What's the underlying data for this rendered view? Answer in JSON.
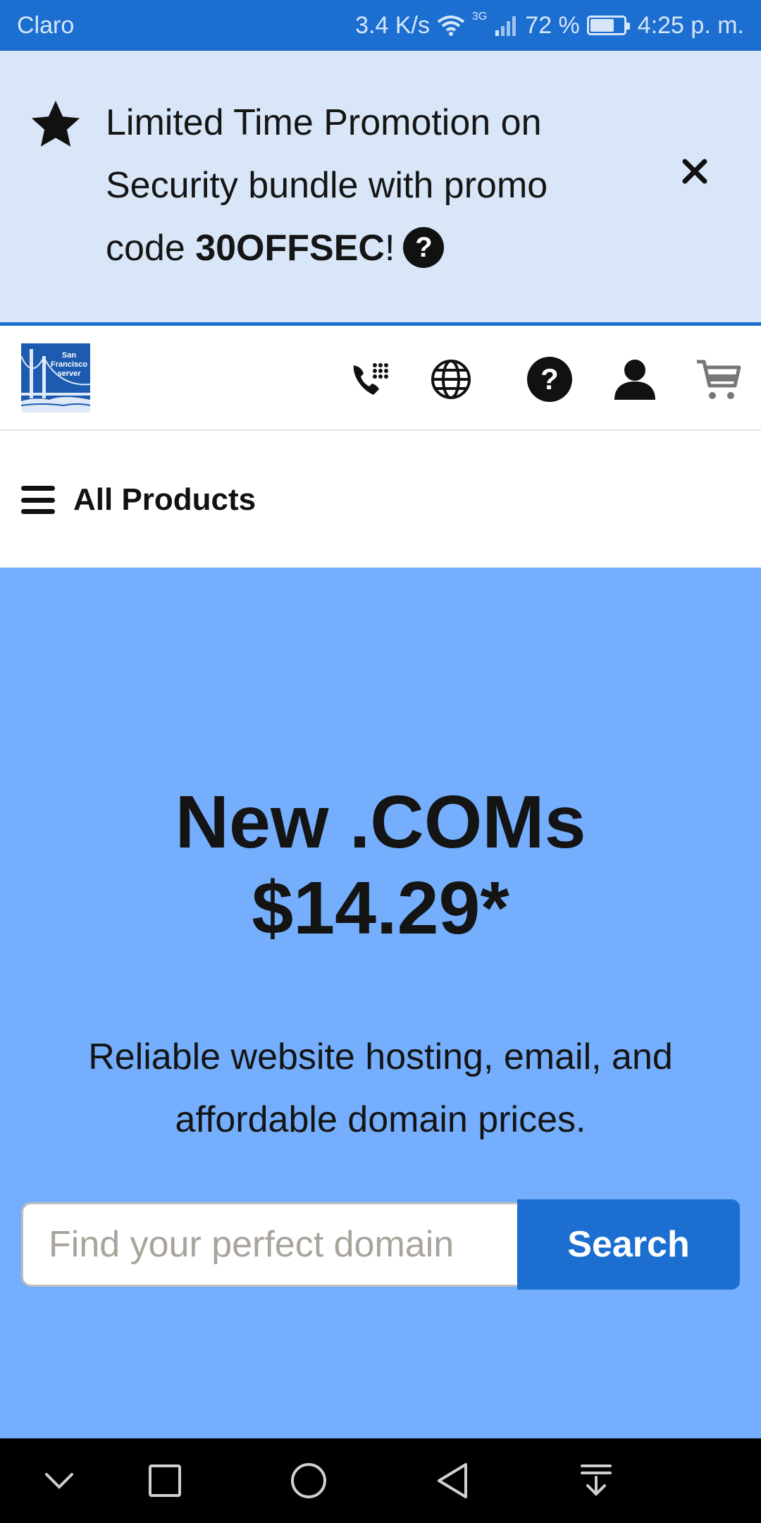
{
  "status_bar": {
    "carrier": "Claro",
    "speed": "3.4 K/s",
    "network": "3G",
    "battery": "72 %",
    "battery_level": 0.72,
    "time": "4:25 p. m."
  },
  "promo": {
    "line1": "Limited Time Promotion on",
    "line2": "Security bundle with promo",
    "line3_prefix": "code ",
    "code": "30OFFSEC",
    "line3_suffix": "!",
    "help_glyph": "?",
    "icons": {
      "star": "star-icon",
      "help": "help-icon",
      "close": "close-icon"
    }
  },
  "header": {
    "logo_text": "San Francisco server",
    "icons": [
      "phone-dialpad-icon",
      "globe-icon",
      "help-circle-icon",
      "user-icon",
      "cart-icon"
    ]
  },
  "menu": {
    "label": "All Products"
  },
  "hero": {
    "title_line1": "New .COMs",
    "title_line2": "$14.29*",
    "subtitle_line1": "Reliable website hosting, email, and",
    "subtitle_line2": "affordable domain prices.",
    "search_placeholder": "Find your perfect domain",
    "search_button": "Search",
    "background": "#74aefc"
  },
  "navigation_bar": {
    "buttons": [
      "chevron-down-icon",
      "recents-square-icon",
      "home-circle-icon",
      "back-triangle-icon",
      "notification-pull-icon"
    ]
  },
  "colors": {
    "brand_blue": "#1c6fd0",
    "promo_bg": "#d8e6f7",
    "hero_bg": "#74aefc"
  }
}
